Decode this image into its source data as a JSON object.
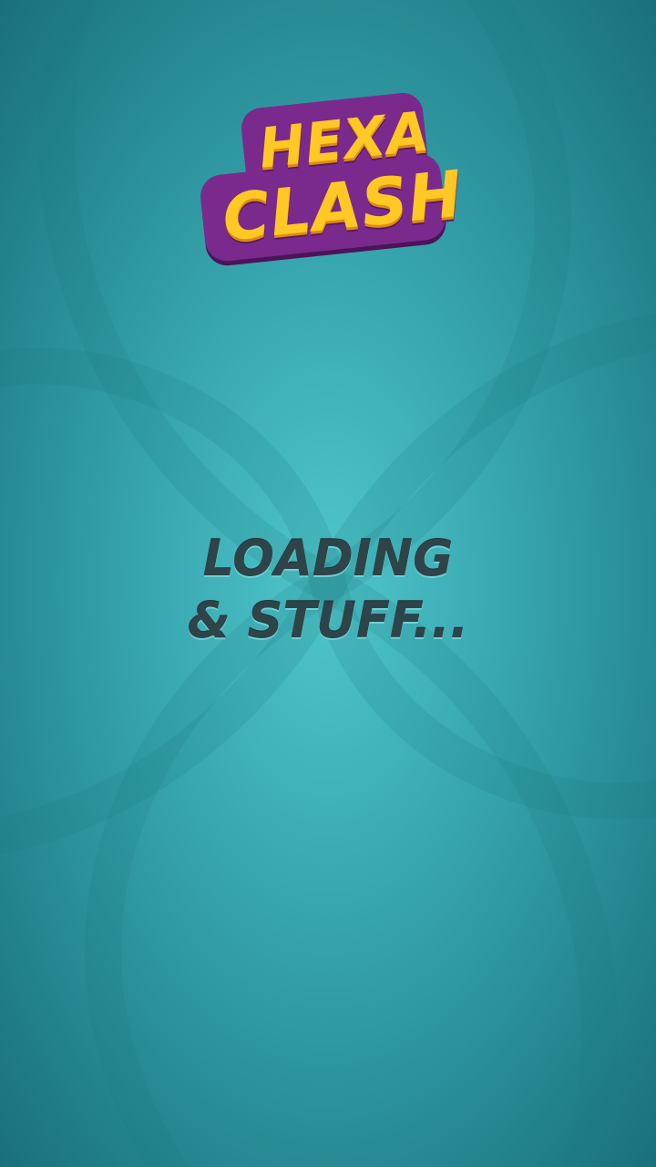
{
  "logo": {
    "line1": "HEXA",
    "line2": "CLASH",
    "colors": {
      "text": "#ffc824",
      "plate": "#7a2a8c"
    }
  },
  "loading": {
    "line1": "LOADING",
    "line2": "& STUFF..."
  },
  "background": {
    "color": "#3aaab2"
  }
}
